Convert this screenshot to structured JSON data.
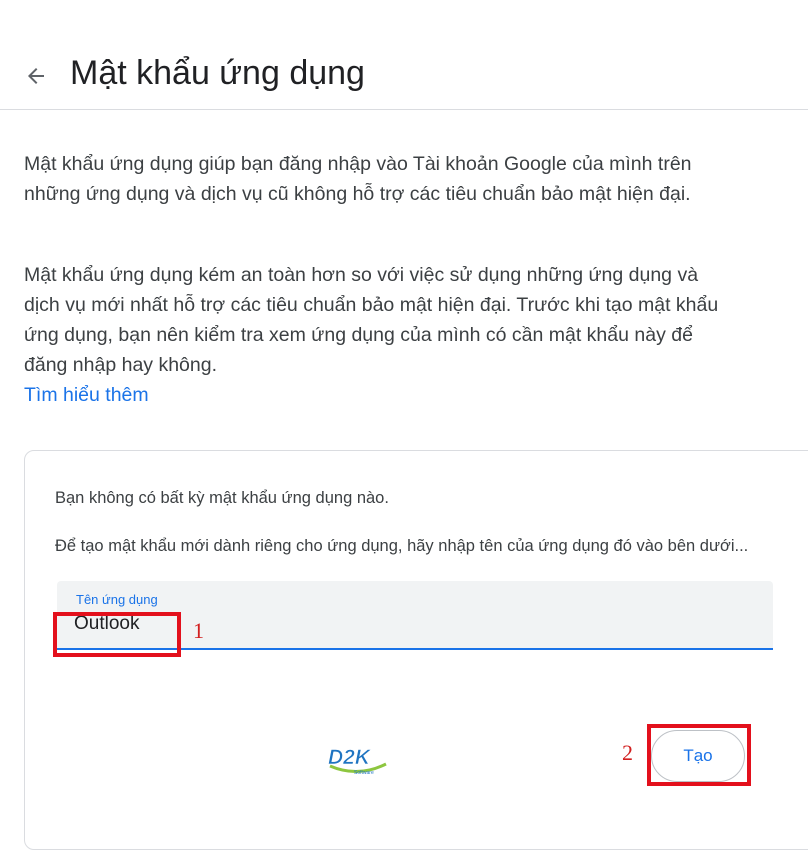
{
  "header": {
    "title": "Mật khẩu ứng dụng",
    "back_icon": "arrow-left-icon"
  },
  "intro": {
    "paragraph1": "Mật khẩu ứng dụng giúp bạn đăng nhập vào Tài khoản Google của mình trên những ứng dụng và dịch vụ cũ không hỗ trợ các tiêu chuẩn bảo mật hiện đại.",
    "paragraph2": "Mật khẩu ứng dụng kém an toàn hơn so với việc sử dụng những ứng dụng và dịch vụ mới nhất hỗ trợ các tiêu chuẩn bảo mật hiện đại. Trước khi tạo mật khẩu ứng dụng, bạn nên kiểm tra xem ứng dụng của mình có cần mật khẩu này để đăng nhập hay không.",
    "learn_more": "Tìm hiểu thêm"
  },
  "card": {
    "empty_message": "Bạn không có bất kỳ mật khẩu ứng dụng nào.",
    "instruction": "Để tạo mật khẩu mới dành riêng cho ứng dụng, hãy nhập tên của ứng dụng đó vào bên dưới...",
    "field_label": "Tên ứng dụng",
    "field_value": "Outlook",
    "create_button": "Tạo"
  },
  "annotations": {
    "step1": "1",
    "step2": "2",
    "highlight_color": "#e3101c"
  },
  "logo": {
    "text": "D2K",
    "subtext": "Software"
  },
  "colors": {
    "accent": "#1a73e8",
    "text": "#202124",
    "muted": "#3c4043",
    "border": "#dadce0"
  }
}
